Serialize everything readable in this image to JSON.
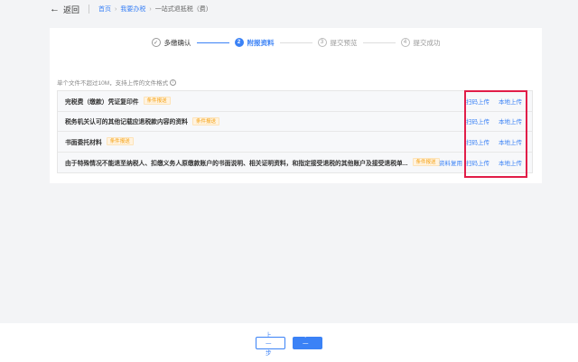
{
  "topbar": {
    "back_label": "返回",
    "breadcrumb": [
      "首页",
      "我要办税",
      "一站式退抵税（费）"
    ]
  },
  "stepper": {
    "steps": [
      {
        "num": "✓",
        "label": "多缴确认"
      },
      {
        "num": "2",
        "label": "附报资料"
      },
      {
        "num": "3",
        "label": "提交预览"
      },
      {
        "num": "4",
        "label": "提交成功"
      }
    ]
  },
  "hint": "单个文件不超过10M，支持上传的文件格式",
  "rows": [
    {
      "name": "完税费（缴款）凭证复印件",
      "tag": "条件报送",
      "reuse": "",
      "scan": "扫码上传",
      "local": "本地上传"
    },
    {
      "name": "税务机关认可的其他记载应退税款内容的资料",
      "tag": "条件报送",
      "reuse": "",
      "scan": "扫码上传",
      "local": "本地上传"
    },
    {
      "name": "书面委托材料",
      "tag": "条件报送",
      "reuse": "",
      "scan": "扫码上传",
      "local": "本地上传"
    },
    {
      "name": "由于特殊情况不能退至纳税人、扣缴义务人原缴款账户的书面说明、相关证明资料，和指定接受退税的其他账户及接受退税单...",
      "tag": "条件报送",
      "reuse": "资料复用",
      "scan": "扫码上传",
      "local": "本地上传"
    }
  ],
  "footer": {
    "prev_label": "上一步",
    "next_label": "下一步"
  },
  "colors": {
    "accent": "#3b82f6",
    "highlight": "#e11d48",
    "tag": "#f59e0b"
  }
}
